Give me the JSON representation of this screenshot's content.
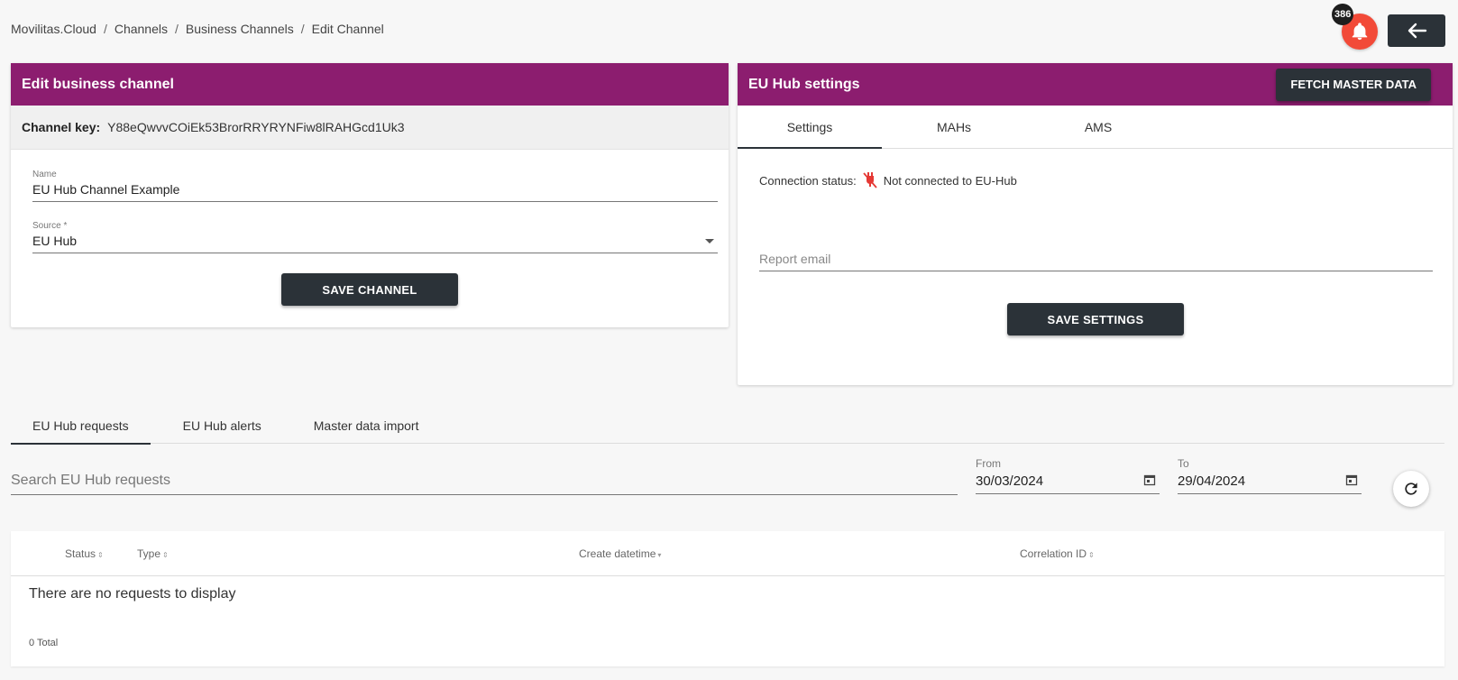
{
  "breadcrumb": [
    "Movilitas.Cloud",
    "Channels",
    "Business Channels",
    "Edit Channel"
  ],
  "notifications": {
    "count": "386"
  },
  "edit_card": {
    "title": "Edit business channel",
    "key_label": "Channel key:",
    "key_value": "Y88eQwvvCOiEk53BrorRRYRYNFiw8lRAHGcd1Uk3",
    "name_label": "Name",
    "name_value": "EU Hub Channel Example",
    "source_label": "Source *",
    "source_value": "EU Hub",
    "save_label": "SAVE CHANNEL"
  },
  "hub_card": {
    "title": "EU Hub settings",
    "fetch_label": "FETCH MASTER DATA",
    "tabs": [
      "Settings",
      "MAHs",
      "AMS"
    ],
    "active_tab": "Settings",
    "connection_label": "Connection status:",
    "connection_value": "Not connected to EU-Hub",
    "report_placeholder": "Report email",
    "save_label": "SAVE SETTINGS"
  },
  "bottom": {
    "tabs": [
      "EU Hub requests",
      "EU Hub alerts",
      "Master data import"
    ],
    "active_tab": "EU Hub requests",
    "search_placeholder": "Search EU Hub requests",
    "from_label": "From",
    "from_value": "30/03/2024",
    "to_label": "To",
    "to_value": "29/04/2024",
    "columns": [
      "Status",
      "Type",
      "Create datetime",
      "Correlation ID"
    ],
    "empty_text": "There are no requests to display",
    "total_text": "0 Total"
  },
  "colors": {
    "header": "#8c1d6f",
    "button": "#2b3238",
    "bell": "#f24a38"
  }
}
